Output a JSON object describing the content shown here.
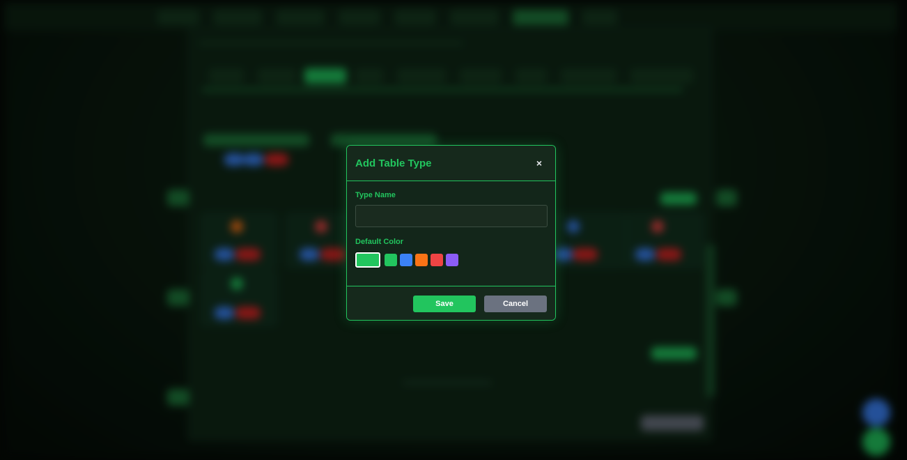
{
  "modal": {
    "title": "Add Table Type",
    "close_label": "×",
    "type_name_label": "Type Name",
    "type_name_value": "",
    "type_name_placeholder": "",
    "default_color_label": "Default Color",
    "selected_color": "#22c55e",
    "color_options": [
      "#22c55e",
      "#3b82f6",
      "#f97316",
      "#ef4444",
      "#8b5cf6"
    ],
    "save_label": "Save",
    "cancel_label": "Cancel"
  },
  "colors": {
    "accent": "#22c55e",
    "cancel": "#6b7280",
    "blue": "#3b82f6",
    "orange": "#f97316",
    "red": "#ef4444",
    "purple": "#8b5cf6"
  }
}
